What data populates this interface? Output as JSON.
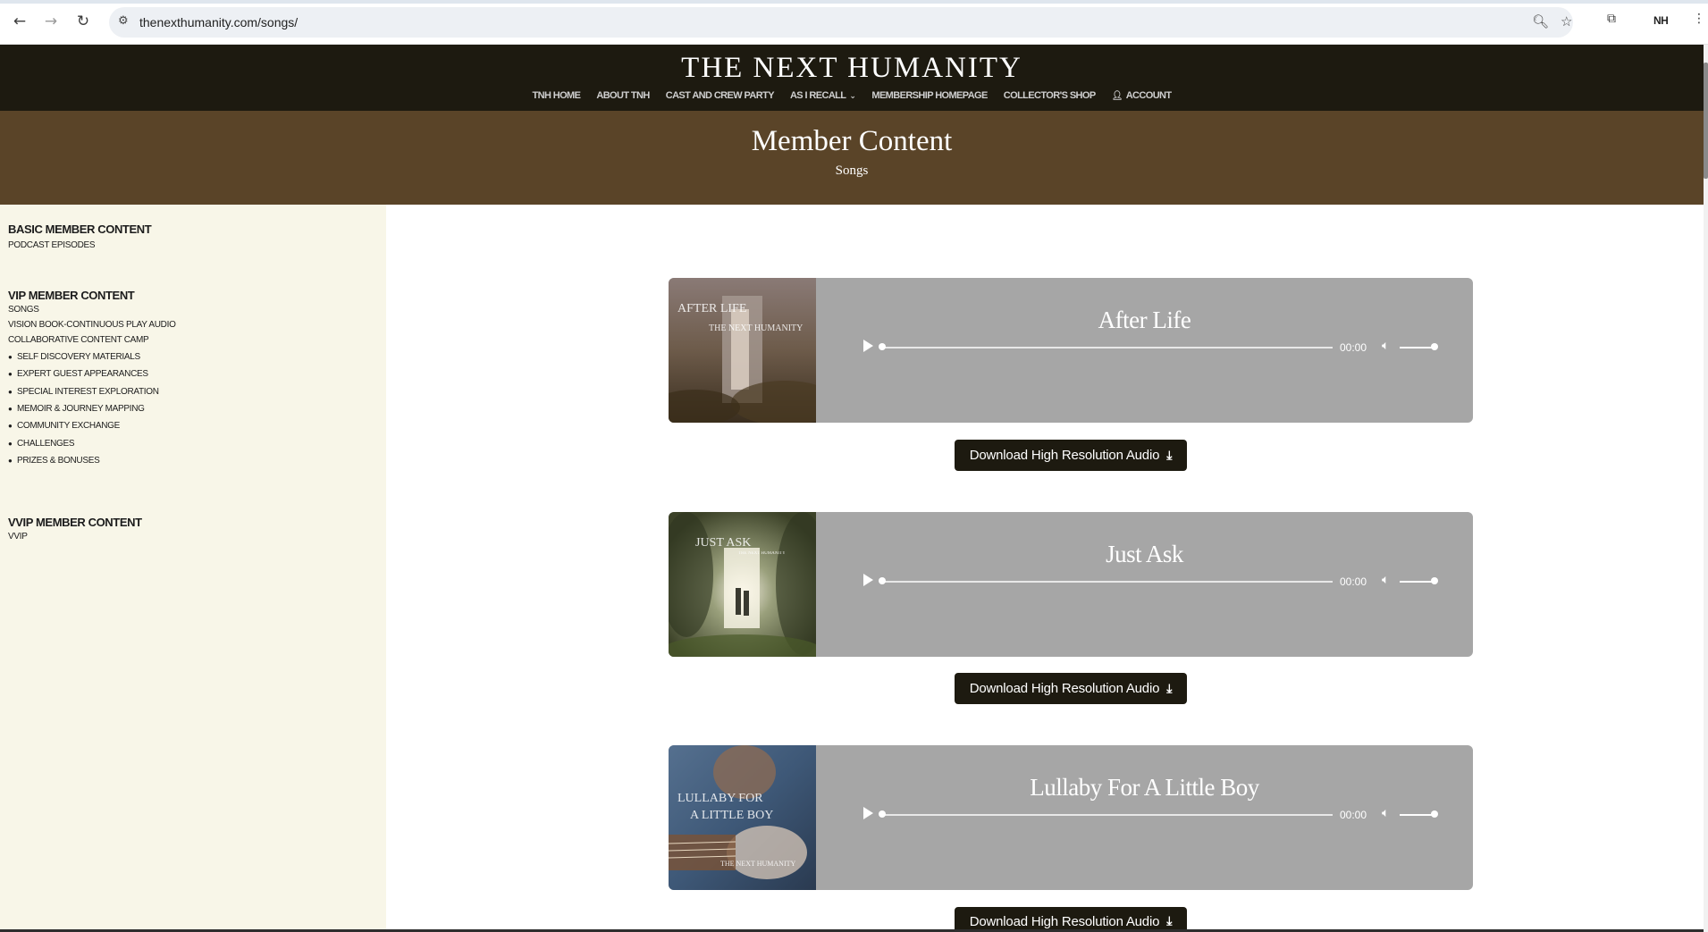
{
  "browser": {
    "url": "thenexthumanity.com/songs/",
    "profile": "NH",
    "icons": {
      "back": "arrow-left-icon",
      "forward": "arrow-right-icon",
      "reload": "reload-icon",
      "site_info": "tune-icon",
      "zoom": "zoom-icon",
      "bookmark": "star-icon",
      "tab_search": "tab-search-icon",
      "menu": "kebab-menu-icon"
    }
  },
  "header": {
    "logo": "THE NEXT HUMANITY",
    "nav": [
      {
        "label": "TNH HOME"
      },
      {
        "label": "ABOUT TNH"
      },
      {
        "label": "CAST AND CREW PARTY"
      },
      {
        "label": "AS I RECALL",
        "has_dropdown": true
      },
      {
        "label": "MEMBERSHIP HOMEPAGE"
      },
      {
        "label": "COLLECTOR'S SHOP"
      },
      {
        "label": "ACCOUNT",
        "icon": "user-icon"
      }
    ],
    "background": "#1d1a10"
  },
  "hero": {
    "title": "Member Content",
    "subtitle": "Songs",
    "background": "#5a4428"
  },
  "sidebar": {
    "basic": {
      "heading": "BASIC MEMBER CONTENT",
      "links": [
        "PODCAST EPISODES"
      ]
    },
    "vip": {
      "heading": "VIP MEMBER CONTENT",
      "links": [
        "SONGS",
        "VISION BOOK-CONTINUOUS PLAY AUDIO",
        "COLLABORATIVE CONTENT CAMP"
      ],
      "list": [
        "SELF DISCOVERY MATERIALS",
        "EXPERT GUEST APPEARANCES",
        "SPECIAL INTEREST EXPLORATION",
        "MEMOIR & JOURNEY MAPPING",
        "COMMUNITY EXCHANGE",
        "CHALLENGES",
        "PRIZES & BONUSES"
      ]
    },
    "vvip": {
      "heading": "VVIP MEMBER CONTENT",
      "links": [
        "VVIP"
      ]
    },
    "background": "#f8f6e8"
  },
  "songs": [
    {
      "title": "After Life",
      "cover_text_1": "AFTER LIFE",
      "cover_text_2": "THE NEXT HUMANITY",
      "time": "00:00",
      "download_label": "Download High Resolution Audio",
      "progress": 0,
      "volume": 1
    },
    {
      "title": "Just Ask",
      "cover_text_1": "JUST ASK",
      "cover_text_2": "THE NEXT HUMANITY",
      "time": "00:00",
      "download_label": "Download High Resolution Audio",
      "progress": 0,
      "volume": 1
    },
    {
      "title": "Lullaby For A Little Boy",
      "cover_text_1": "LULLABY FOR",
      "cover_text_1b": "A LITTLE BOY",
      "cover_text_2": "THE NEXT HUMANITY",
      "time": "00:00",
      "download_label": "Download High Resolution Audio",
      "progress": 0,
      "volume": 1
    }
  ],
  "colors": {
    "card": "#a6a6a6",
    "button": "#1d1a10"
  }
}
